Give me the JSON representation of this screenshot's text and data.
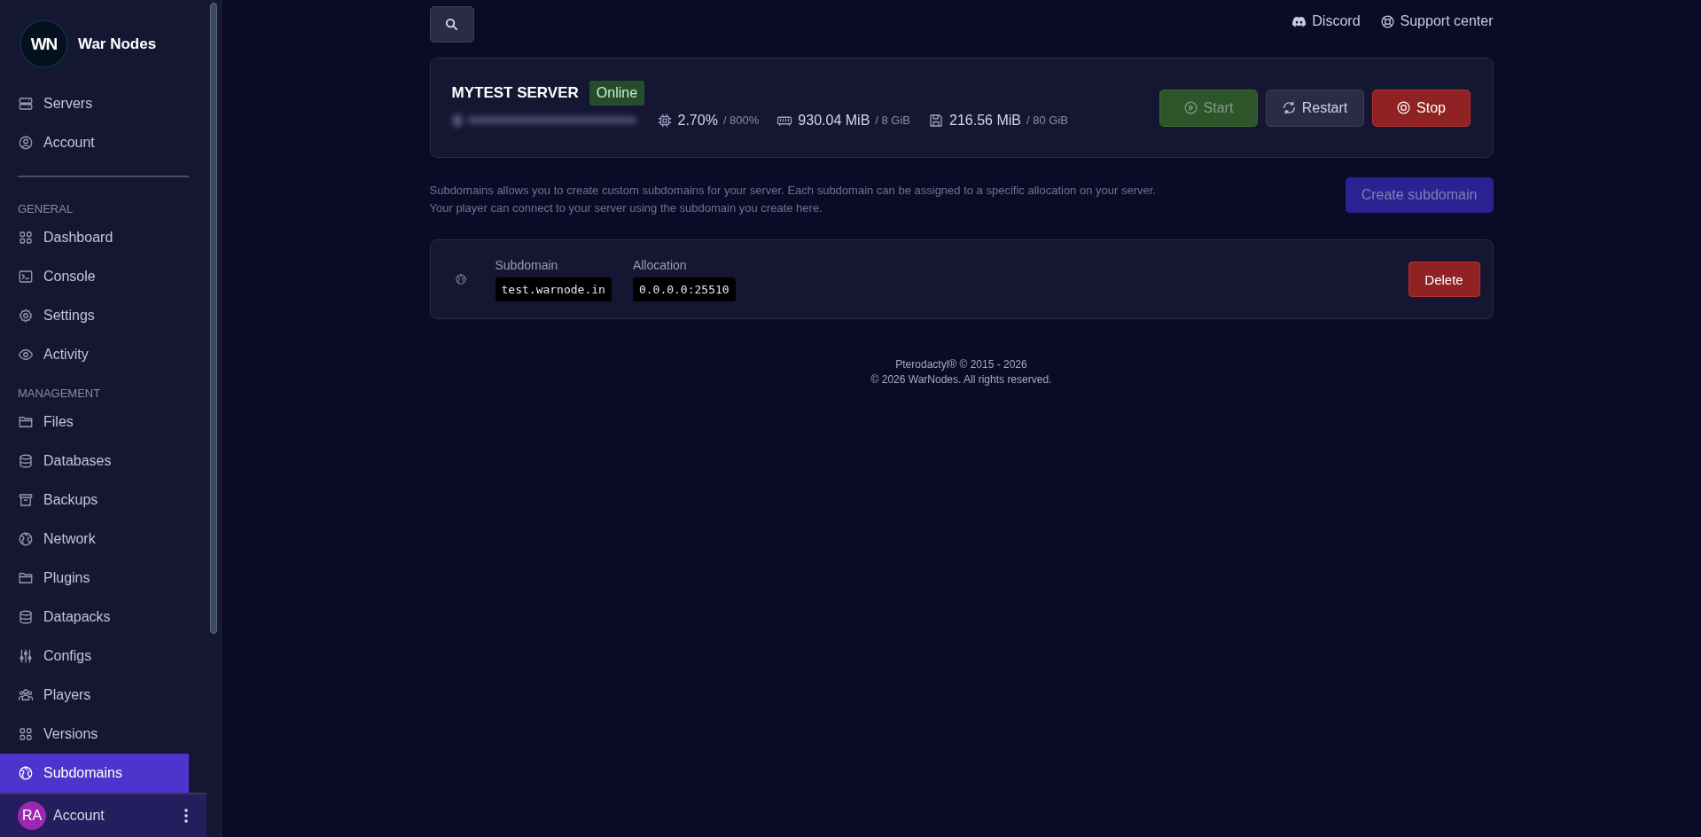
{
  "sidebar": {
    "brand": {
      "name": "War Nodes",
      "logo_text": "WN"
    },
    "top_items": [
      {
        "label": "Servers",
        "kind": "server",
        "selected": false
      },
      {
        "label": "Account",
        "kind": "user",
        "selected": false
      }
    ],
    "sections": [
      {
        "heading": "GENERAL",
        "items": [
          {
            "label": "Dashboard",
            "kind": "grid",
            "selected": false
          },
          {
            "label": "Console",
            "kind": "terminal",
            "selected": false
          },
          {
            "label": "Settings",
            "kind": "gear",
            "selected": false
          },
          {
            "label": "Activity",
            "kind": "eye",
            "selected": false
          }
        ]
      },
      {
        "heading": "MANAGEMENT",
        "items": [
          {
            "label": "Files",
            "kind": "folder",
            "selected": false
          },
          {
            "label": "Databases",
            "kind": "database",
            "selected": false
          },
          {
            "label": "Backups",
            "kind": "archive",
            "selected": false
          },
          {
            "label": "Network",
            "kind": "globe",
            "selected": false
          },
          {
            "label": "Plugins",
            "kind": "folder",
            "selected": false
          },
          {
            "label": "Datapacks",
            "kind": "database",
            "selected": false
          },
          {
            "label": "Configs",
            "kind": "sliders",
            "selected": false
          },
          {
            "label": "Players",
            "kind": "users",
            "selected": false
          },
          {
            "label": "Versions",
            "kind": "grid",
            "selected": false
          },
          {
            "label": "Subdomains",
            "kind": "globe",
            "selected": true
          }
        ]
      }
    ],
    "account": {
      "initials": "RA",
      "label": "Account"
    }
  },
  "header": {
    "links": [
      {
        "label": "Discord",
        "kind": "discord"
      },
      {
        "label": "Support center",
        "kind": "lifebuoy"
      }
    ]
  },
  "server": {
    "name": "MYTEST SERVER",
    "status": "Online",
    "stats": [
      {
        "kind": "cpu",
        "value": "2.70%",
        "limit": "/ 800%"
      },
      {
        "kind": "memory",
        "value": "930.04 MiB",
        "limit": "/ 8 GiB"
      },
      {
        "kind": "save",
        "value": "216.56 MiB",
        "limit": "/ 80 GiB"
      }
    ],
    "buttons": [
      {
        "label": "Start",
        "kind": "start",
        "disabled": true
      },
      {
        "label": "Restart",
        "kind": "restart",
        "disabled": false
      },
      {
        "label": "Stop",
        "kind": "stop",
        "disabled": false
      }
    ]
  },
  "subdomains": {
    "description": "Subdomains allows you to create custom subdomains for your server. Each subdomain can be assigned to a specific allocation on your server.\nYour player can connect to your server using the subdomain you create here.",
    "create_button": {
      "label": "Create subdomain",
      "disabled": true
    },
    "entries": [
      {
        "subdomain_label": "Subdomain",
        "subdomain": "test.warnode.in",
        "allocation_label": "Allocation",
        "allocation": "0.0.0.0:25510",
        "delete_label": "Delete"
      }
    ]
  },
  "footer": [
    "Pterodactyl® © 2015 - 2026",
    "© 2026 WarNodes. All rights reserved."
  ]
}
